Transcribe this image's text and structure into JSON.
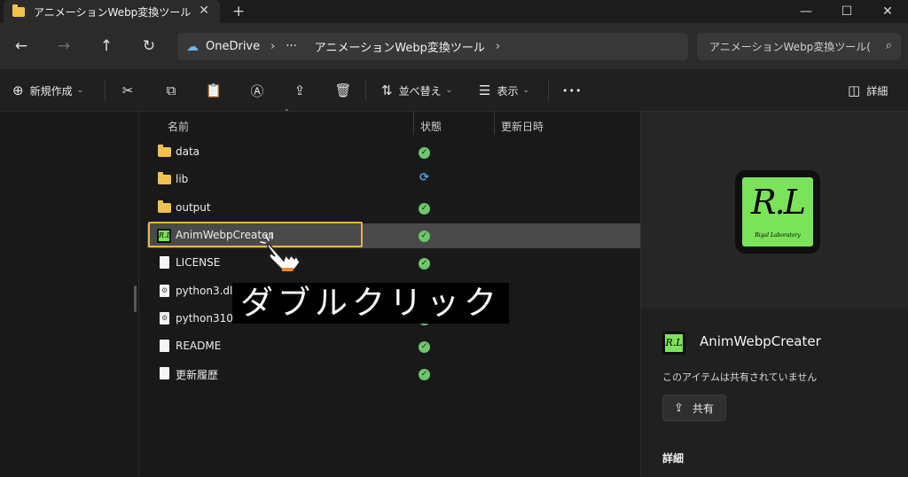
{
  "tab": {
    "title": "アニメーションWebp変換ツール",
    "close": "✕",
    "new": "+"
  },
  "window": {
    "minimize": "—",
    "maximize": "☐",
    "close": "✕"
  },
  "nav": {
    "back": "←",
    "forward": "→",
    "up": "↑",
    "refresh": "↻"
  },
  "address": {
    "cloud_icon": "☁",
    "root": "OneDrive",
    "sep1": "›",
    "overflow": "···",
    "folder": "アニメーションWebp変換ツール",
    "sep2": "›"
  },
  "search": {
    "placeholder": "アニメーションWebp変換ツール(",
    "icon": "⌕"
  },
  "toolbar": {
    "new_icon": "⊕",
    "new_label": "新規作成",
    "new_chevron": "⌄",
    "cut_icon": "✂",
    "copy_icon": "⧉",
    "paste_icon": "📋",
    "rename_icon": "Ⓐ",
    "share_icon": "⇪",
    "delete_icon": "🗑",
    "sort_icon": "⇅",
    "sort_label": "並べ替え",
    "sort_chevron": "⌄",
    "view_icon": "☰",
    "view_label": "表示",
    "view_chevron": "⌄",
    "more": "•••",
    "details_icon": "◫",
    "details_label": "詳細"
  },
  "columns": {
    "name": "名前",
    "status": "状態",
    "modified": "更新日時",
    "sort_caret": "⌃"
  },
  "files": [
    {
      "name": "data",
      "type": "folder",
      "status": "synced"
    },
    {
      "name": "lib",
      "type": "folder",
      "status": "syncing"
    },
    {
      "name": "output",
      "type": "folder",
      "status": "synced"
    },
    {
      "name": "AnimWebpCreater",
      "type": "app",
      "status": "synced",
      "selected": true
    },
    {
      "name": "LICENSE",
      "type": "file",
      "status": "synced"
    },
    {
      "name": "python3.dll",
      "type": "dll",
      "status": "synced"
    },
    {
      "name": "python310.dll",
      "type": "dll",
      "status": "synced"
    },
    {
      "name": "README",
      "type": "file",
      "status": "synced"
    },
    {
      "name": "更新履歴",
      "type": "file",
      "status": "synced"
    }
  ],
  "status_icons": {
    "synced": "✓",
    "syncing": "⟳"
  },
  "app_icon_text": "R.L",
  "caption": "ダブルクリック",
  "details": {
    "logo_mark": "R.L",
    "logo_sub": "Rigal Laboratory",
    "name": "AnimWebpCreater",
    "share_text": "このアイテムは共有されていません",
    "share_icon": "⇪",
    "share_button": "共有",
    "section": "詳細"
  },
  "colors": {
    "accent_highlight": "#e6b34a",
    "folder": "#f2c14e",
    "synced": "#6cc66c",
    "brand_green": "#7be35a"
  }
}
